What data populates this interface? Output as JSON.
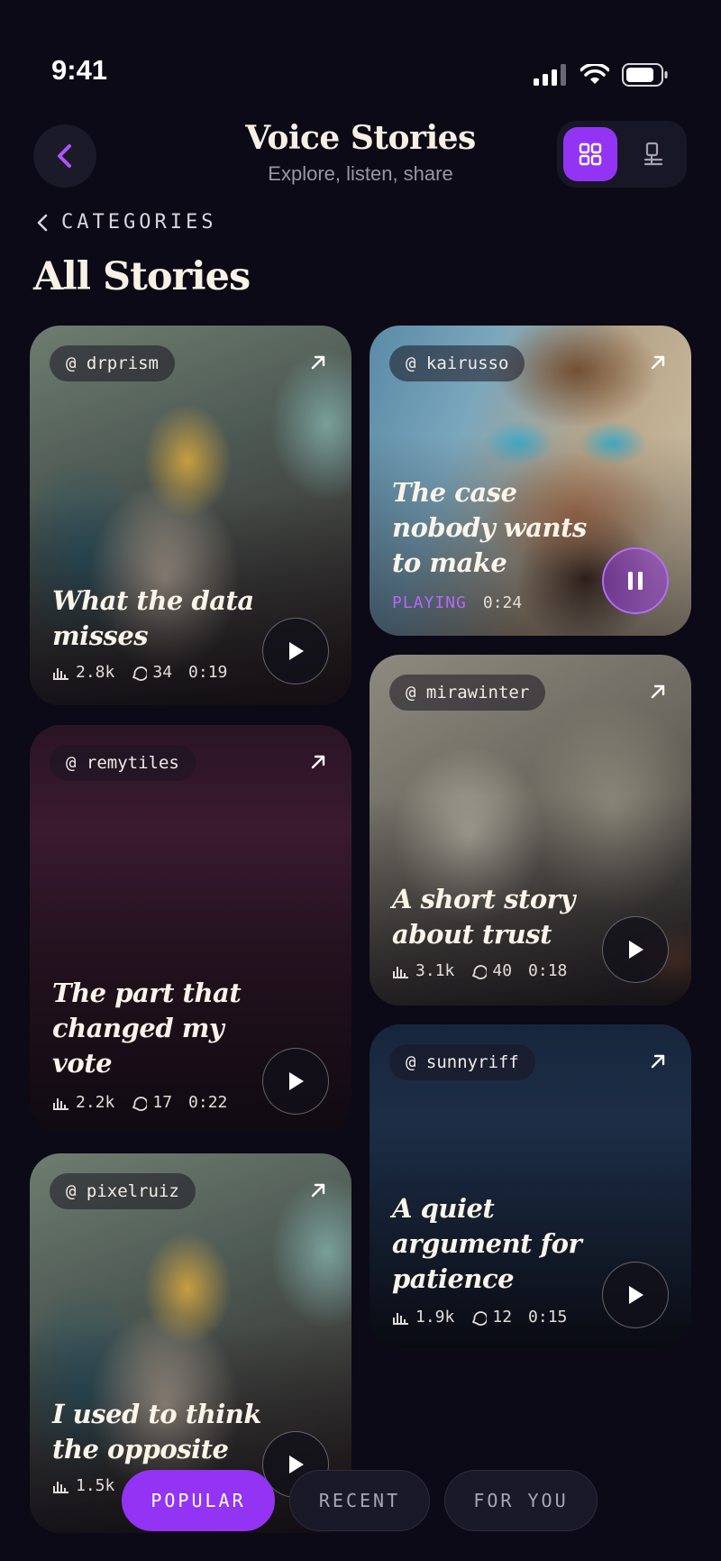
{
  "status": {
    "time": "9:41"
  },
  "header": {
    "title": "Voice Stories",
    "subtitle": "Explore, listen, share"
  },
  "nav": {
    "categories_label": "CATEGORIES",
    "section_title": "All Stories"
  },
  "cards": [
    {
      "handle": "@ drprism",
      "title_lines": [
        "What the data",
        "misses"
      ],
      "plays": "2.8k",
      "comments": "34",
      "duration": "0:19"
    },
    {
      "handle": "@ kairusso",
      "title_lines": [
        "The case",
        "nobody wants",
        "to make"
      ],
      "status": "PLAYING",
      "duration": "0:24"
    },
    {
      "handle": "@ remytiles",
      "title_lines": [
        "The part that",
        "changed my",
        "vote"
      ],
      "plays": "2.2k",
      "comments": "17",
      "duration": "0:22"
    },
    {
      "handle": "@ mirawinter",
      "title_lines": [
        "A short story",
        "about trust"
      ],
      "plays": "3.1k",
      "comments": "40",
      "duration": "0:18"
    },
    {
      "handle": "@ pixelruiz",
      "title_lines": [
        "I used to think",
        "the opposite"
      ],
      "plays": "1.5k"
    },
    {
      "handle": "@ sunnyriff",
      "title_lines": [
        "A quiet",
        "argument for",
        "patience"
      ],
      "plays": "1.9k",
      "comments": "12",
      "duration": "0:15"
    }
  ],
  "tabs": {
    "popular": "POPULAR",
    "recent": "RECENT",
    "for_you": "FOR YOU"
  },
  "colors": {
    "accent": "#9334f5",
    "background": "#0b0a16"
  }
}
